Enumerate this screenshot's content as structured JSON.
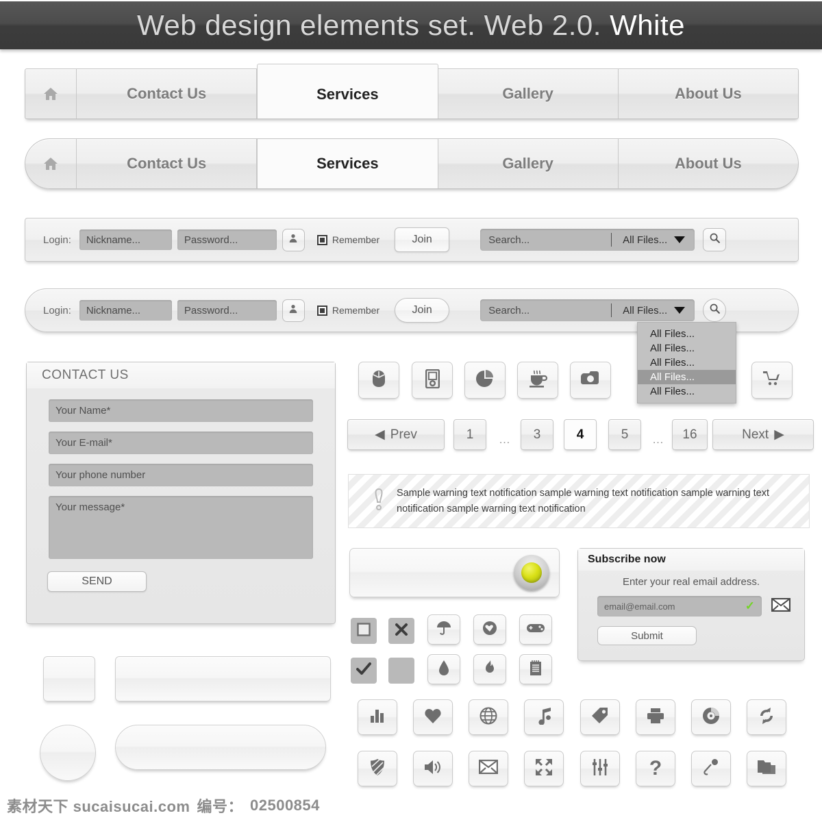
{
  "title": {
    "main": "Web design elements set. Web 2.0. ",
    "highlight": "White"
  },
  "nav": {
    "home_icon": "home-icon",
    "items": [
      {
        "label": "Contact Us",
        "active": false
      },
      {
        "label": "Services",
        "active": true
      },
      {
        "label": "Gallery",
        "active": false
      },
      {
        "label": "About Us",
        "active": false
      }
    ]
  },
  "login_bar": {
    "label": "Login:",
    "nickname_placeholder": "Nickname...",
    "password_placeholder": "Password...",
    "user_icon": "user-icon",
    "remember_label": "Remember",
    "join_label": "Join",
    "search_placeholder": "Search...",
    "filter_value": "All Files...",
    "caret_icon": "chevron-down-icon",
    "search_icon": "search-icon"
  },
  "dropdown": {
    "options": [
      "All Files...",
      "All Files...",
      "All Files...",
      "All Files...",
      "All Files..."
    ],
    "selected_index": 3
  },
  "contact_form": {
    "title": "CONTACT US",
    "name_placeholder": "Your Name*",
    "email_placeholder": "Your E-mail*",
    "phone_placeholder": "Your phone number",
    "message_placeholder": "Your message*",
    "send_label": "SEND"
  },
  "pagination": {
    "prev_label": "Prev",
    "next_label": "Next",
    "prev_icon": "chevron-left-icon",
    "next_icon": "chevron-right-icon",
    "pages": [
      "1",
      "…",
      "3",
      "4",
      "5",
      "…",
      "16"
    ],
    "current_page": "4"
  },
  "warning": {
    "icon": "exclamation-icon",
    "text": "Sample warning text notification sample warning text notification sample warning text notification sample warning text notification"
  },
  "subscribe": {
    "title": "Subscribe now",
    "subtitle": "Enter your real email address.",
    "email_placeholder": "email@email.com",
    "valid_icon": "check-icon",
    "valid_color": "#74d427",
    "mail_icon": "envelope-icon",
    "submit_label": "Submit"
  },
  "toggle_slider": {
    "knob_icon": "slider-knob",
    "knob_color": "#d9e016"
  },
  "icon_rows": {
    "row_media": [
      "mouse-icon",
      "mp3-player-icon",
      "pie-chart-icon",
      "coffee-cup-icon",
      "camera-icon"
    ],
    "cart": "shopping-cart-icon",
    "flat_grid": [
      "stop-square-icon",
      "close-x-icon",
      "check-mark-icon",
      "blank-square-icon"
    ],
    "grid_small": [
      "umbrella-icon",
      "heart-circle-icon",
      "gamepad-icon",
      "droplet-icon",
      "fire-icon",
      "notepad-icon"
    ],
    "row_a": [
      "bar-chart-icon",
      "heart-icon",
      "globe-icon",
      "music-note-icon",
      "tag-icon",
      "printer-icon",
      "cd-disc-icon",
      "refresh-icon"
    ],
    "row_b": [
      "shield-icon",
      "speaker-icon",
      "envelope-icon",
      "fullscreen-icon",
      "equalizer-icon",
      "help-question-icon",
      "microphone-icon",
      "folder-icon"
    ]
  },
  "blank_buttons": [
    "square-button",
    "bar-button",
    "circle-button",
    "pill-button"
  ],
  "footer": {
    "site": "素材天下 sucaisucai.com",
    "id_label": "编号：",
    "id_value": "02500854"
  }
}
